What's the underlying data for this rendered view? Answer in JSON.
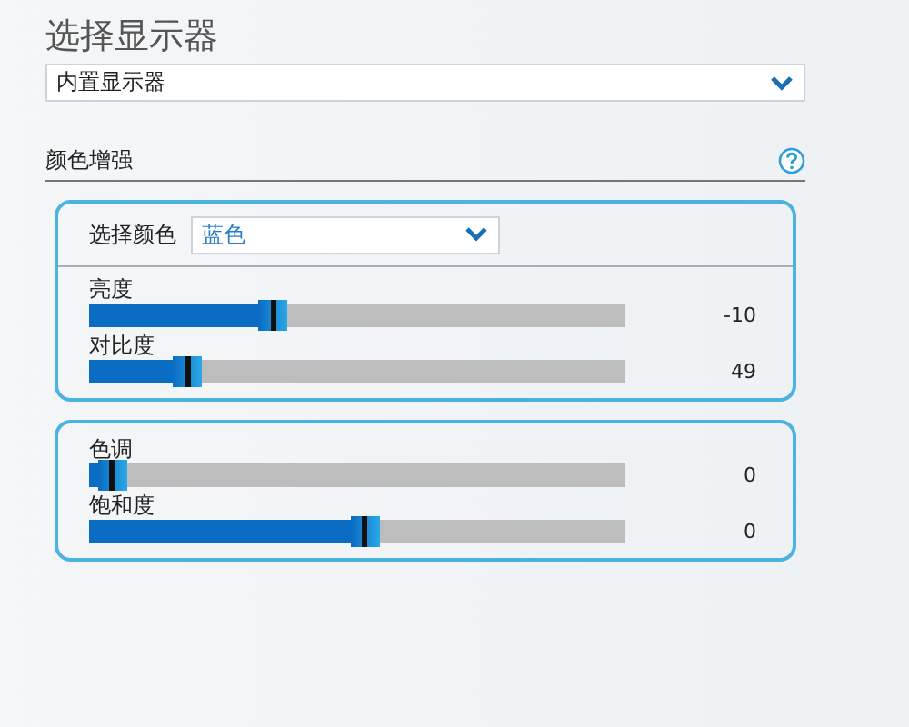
{
  "title": "选择显示器",
  "display_select": {
    "value": "内置显示器"
  },
  "section": {
    "title": "颜色增强"
  },
  "groups": [
    {
      "color_select": {
        "label": "选择颜色",
        "value": "蓝色"
      },
      "sliders": [
        {
          "label": "亮度",
          "level": 0.33,
          "reading": "-10"
        },
        {
          "label": "对比度",
          "level": 0.17,
          "reading": "49"
        }
      ]
    },
    {
      "sliders": [
        {
          "label": "色调",
          "level": 0.03,
          "reading": "0"
        },
        {
          "label": "饱和度",
          "level": 0.5,
          "reading": "0"
        }
      ]
    }
  ]
}
